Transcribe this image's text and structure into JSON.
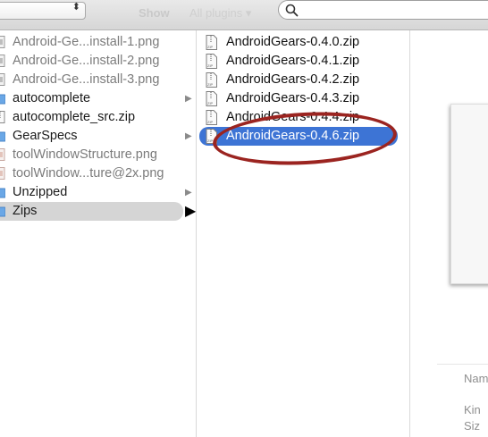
{
  "toolbar": {
    "popup_arrows": "⬍",
    "show_label": "Show",
    "show_value": "All plugins ▾"
  },
  "col1": {
    "items": [
      {
        "label": "Android-Ge...install-1.png",
        "kind": "image-file",
        "faded": true
      },
      {
        "label": "Android-Ge...install-2.png",
        "kind": "image-file",
        "faded": true
      },
      {
        "label": "Android-Ge...install-3.png",
        "kind": "image-file",
        "faded": true
      },
      {
        "label": "autocomplete",
        "kind": "folder",
        "chevron": "▶"
      },
      {
        "label": "autocomplete_src.zip",
        "kind": "zip-file"
      },
      {
        "label": "GearSpecs",
        "kind": "folder",
        "chevron": "▶"
      },
      {
        "label": "toolWindowStructure.png",
        "kind": "image-file",
        "faded": true
      },
      {
        "label": "toolWindow...ture@2x.png",
        "kind": "image-file",
        "faded": true
      },
      {
        "label": "Unzipped",
        "kind": "folder",
        "chevron": "▶"
      },
      {
        "label": "Zips",
        "kind": "folder",
        "chevron": "▶",
        "selected": true
      }
    ]
  },
  "col2": {
    "items": [
      {
        "label": "AndroidGears-0.4.0.zip"
      },
      {
        "label": "AndroidGears-0.4.1.zip"
      },
      {
        "label": "AndroidGears-0.4.2.zip"
      },
      {
        "label": "AndroidGears-0.4.3.zip"
      },
      {
        "label": "AndroidGears-0.4.4.zip"
      },
      {
        "label": "AndroidGears-0.4.6.zip",
        "selected": true
      }
    ]
  },
  "info": {
    "name_label": "Nam",
    "kind_label": "Kin",
    "size_label": "Siz"
  },
  "colors": {
    "selection": "#3d74d5",
    "annotation": "#9b2420",
    "folder": "#6aa7e6"
  }
}
